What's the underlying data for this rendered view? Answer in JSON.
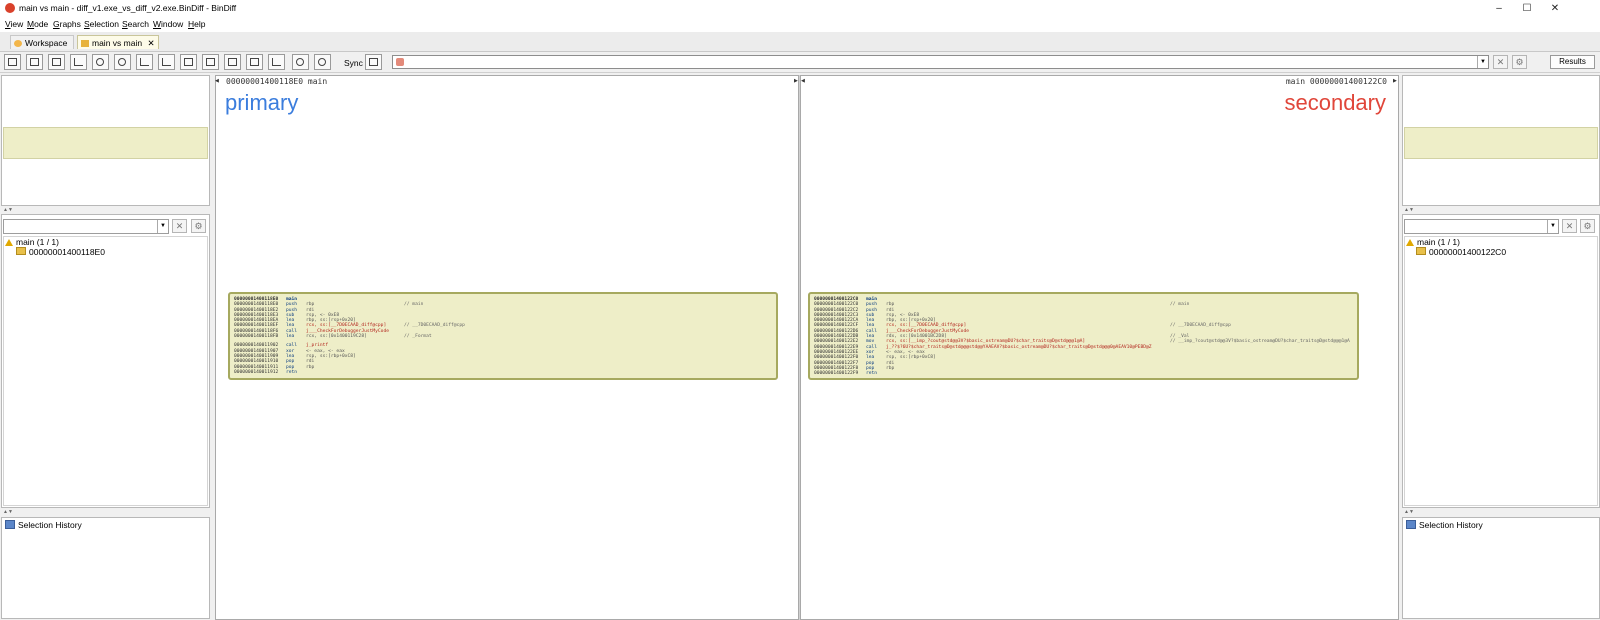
{
  "window": {
    "title": "main vs main - diff_v1.exe_vs_diff_v2.exe.BinDiff - BinDiff",
    "controls": [
      "–",
      "☐",
      "✕"
    ]
  },
  "menu": [
    "View",
    "Mode",
    "Graphs",
    "Selection",
    "Search",
    "Window",
    "Help"
  ],
  "tabs": [
    {
      "label": "Workspace",
      "active": false
    },
    {
      "label": "main vs main",
      "active": true,
      "close": "✕"
    }
  ],
  "toolbar": {
    "sync_label": "Sync",
    "search_value": "",
    "results_label": "Results",
    "clear_glyph": "✕",
    "settings_glyph": "⚙"
  },
  "colors": {
    "primary_label": "#3b7ddd",
    "secondary_label": "#e0463a",
    "node_fill": "#eeeec8",
    "node_border": "#a6a95f"
  },
  "left_sidebar": {
    "tree_root": "main (1 / 1)",
    "tree_child": "00000001400118E0",
    "history_title": "Selection History"
  },
  "right_sidebar": {
    "tree_root": "main (1 / 1)",
    "tree_child": "00000001400122C0",
    "history_title": "Selection History"
  },
  "primary": {
    "header": "00000001400118E0 main",
    "label": "primary",
    "lines": [
      {
        "addr": "00000001400118E0",
        "mn": "main",
        "op": "",
        "cm": ""
      },
      {
        "addr": "00000001400118E0",
        "mn": "push",
        "op": "rbp",
        "cm": "// main"
      },
      {
        "addr": "00000001400118E2",
        "mn": "push",
        "op": "rdi",
        "cm": ""
      },
      {
        "addr": "00000001400118E3",
        "mn": "sub",
        "op": "rsp, <- 0xE8",
        "cm": ""
      },
      {
        "addr": "00000001400118EA",
        "mn": "lea",
        "op": "rbp, ss:[rsp+0x20]",
        "cm": ""
      },
      {
        "addr": "00000001400118EF",
        "mn": "lea",
        "op": "rcx, ss:[__7D0ECAAD_diff@cpp]",
        "cm": "// __7D0ECAAD_diff@cpp"
      },
      {
        "addr": "00000001400118F6",
        "mn": "call",
        "op": "j___CheckForDebuggerJustMyCode",
        "cm": ""
      },
      {
        "addr": "00000001400118FB",
        "mn": "lea",
        "op": "rcx, ss:[0x1400119C28]",
        "cm": "// _Format"
      },
      {
        "gap": true
      },
      {
        "addr": "0000000140011902",
        "mn": "call",
        "op": "j_printf",
        "cm": ""
      },
      {
        "addr": "0000000140011907",
        "mn": "xor",
        "op": "<- eax, <- eax",
        "cm": ""
      },
      {
        "addr": "0000000140011909",
        "mn": "lea",
        "op": "rsp, ss:[rbp+0xC8]",
        "cm": ""
      },
      {
        "addr": "0000000140011910",
        "mn": "pop",
        "op": "rdi",
        "cm": ""
      },
      {
        "addr": "0000000140011911",
        "mn": "pop",
        "op": "rbp",
        "cm": ""
      },
      {
        "addr": "0000000140011912",
        "mn": "retn",
        "op": "",
        "cm": ""
      }
    ]
  },
  "secondary": {
    "header": "main 00000001400122C0",
    "label": "secondary",
    "lines": [
      {
        "addr": "00000001400122C0",
        "mn": "main",
        "op": "",
        "cm": ""
      },
      {
        "addr": "00000001400122C0",
        "mn": "push",
        "op": "rbp",
        "cm": "// main"
      },
      {
        "addr": "00000001400122C2",
        "mn": "push",
        "op": "rdi",
        "cm": ""
      },
      {
        "addr": "00000001400122C3",
        "mn": "sub",
        "op": "rsp, <- 0xE8",
        "cm": ""
      },
      {
        "addr": "00000001400122CA",
        "mn": "lea",
        "op": "rbp, ss:[rsp+0x20]",
        "cm": ""
      },
      {
        "addr": "00000001400122CF",
        "mn": "lea",
        "op": "rcx, ss:[__7D0ECAAD_diff@cpp]",
        "cm": "// __7D0ECAAD_diff@cpp"
      },
      {
        "addr": "00000001400122D6",
        "mn": "call",
        "op": "j___CheckForDebuggerJustMyCode",
        "cm": ""
      },
      {
        "addr": "00000001400122DB",
        "mn": "lea",
        "op": "rdx, ss:[0x14001BC2D8]",
        "cm": "// _Val"
      },
      {
        "addr": "00000001400122E2",
        "mn": "mov",
        "op": "rcx, ss:[__imp_?cout@std@@3V?$basic_ostream@DU?$char_traits@D@std@@@1@A]",
        "cm": "// __imp_?cout@std@@3V?$basic_ostream@DU?$char_traits@D@std@@@1@A"
      },
      {
        "addr": "00000001400122E9",
        "mn": "call",
        "op": "j_??$?6U?$char_traits@D@std@@@std@@YAAEAV?$basic_ostream@DU?$char_traits@D@std@@@0@AEAV10@PEBD@Z",
        "cm": ""
      },
      {
        "addr": "00000001400122EE",
        "mn": "xor",
        "op": "<- eax, <- eax",
        "cm": ""
      },
      {
        "addr": "00000001400122F0",
        "mn": "lea",
        "op": "rsp, ss:[rbp+0xC8]",
        "cm": ""
      },
      {
        "addr": "00000001400122F7",
        "mn": "pop",
        "op": "rdi",
        "cm": ""
      },
      {
        "addr": "00000001400122F8",
        "mn": "pop",
        "op": "rbp",
        "cm": ""
      },
      {
        "addr": "00000001400122F9",
        "mn": "retn",
        "op": "",
        "cm": ""
      }
    ]
  }
}
